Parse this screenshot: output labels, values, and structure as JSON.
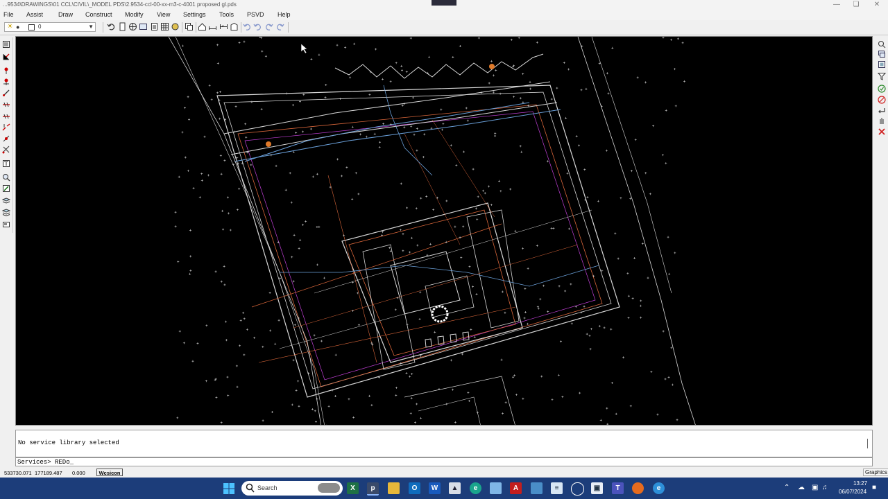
{
  "window": {
    "title": "...9534\\DRAWINGS\\01 CCL\\CIVIL\\_MODEL PDS\\2.9534-ccl-00-xx-m3-c-4001 proposed gl.pds"
  },
  "menu": {
    "items": [
      "File",
      "Assist",
      "Draw",
      "Construct",
      "Modify",
      "View",
      "Settings",
      "Tools",
      "PSVD",
      "Help"
    ]
  },
  "toolbar": {
    "layer_name": "0"
  },
  "command": {
    "message": "No service library selected",
    "prompt": "Services> REDo_"
  },
  "status": {
    "x": "533730.071",
    "y": "177189.487",
    "z": "0.000",
    "mode": "Wcsicon",
    "graphics": "Graphics"
  },
  "taskbar": {
    "search_placeholder": "Search",
    "time": "13:27",
    "date": "06/07/2024"
  },
  "colors": {
    "canvas_bg": "#000000",
    "taskbar_bg": "#1c3d7a",
    "linework_white": "#d8d8d8",
    "linework_orange": "#d9663a",
    "linework_blue": "#6a9fd8",
    "linework_magenta": "#c23fd8"
  },
  "icons": {
    "window_minimize": "minimize-icon",
    "window_maximize": "maximize-icon",
    "window_close": "close-icon",
    "start": "windows-start-icon",
    "search": "search-icon"
  }
}
